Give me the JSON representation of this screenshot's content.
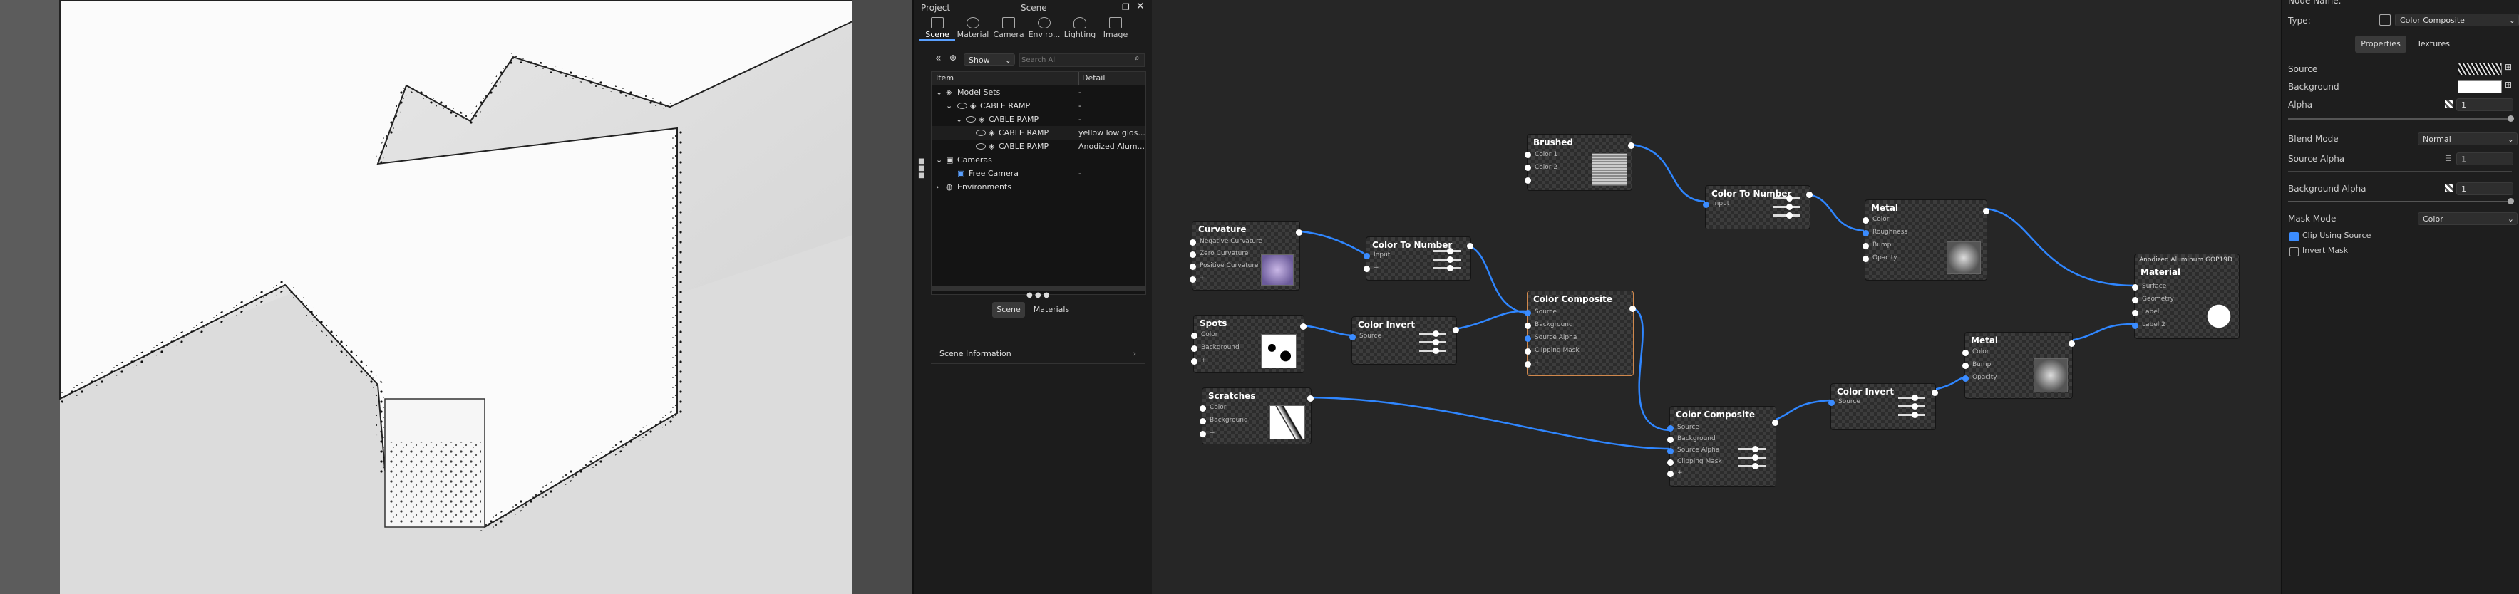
{
  "scene_panel": {
    "project_label": "Project",
    "scene_label": "Scene",
    "tabs": [
      "Scene",
      "Material",
      "Camera",
      "Enviro...",
      "Lighting",
      "Image"
    ],
    "show_select": "Show",
    "search_placeholder": "Search All",
    "columns": [
      "Item",
      "Detail"
    ],
    "rows": [
      {
        "label": "Model Sets",
        "detail": "-"
      },
      {
        "label": "CABLE RAMP",
        "detail": "-"
      },
      {
        "label": "CABLE RAMP",
        "detail": "-"
      },
      {
        "label": "CABLE RAMP",
        "detail": "yellow low glos..."
      },
      {
        "label": "CABLE RAMP",
        "detail": "Anodized Alum..."
      },
      {
        "label": "Cameras",
        "detail": ""
      },
      {
        "label": "Free Camera",
        "detail": "-"
      },
      {
        "label": "Environments",
        "detail": ""
      }
    ],
    "bottom_tabs": [
      "Scene",
      "Materials"
    ],
    "scene_information": "Scene Information"
  },
  "nodes": {
    "brushed": {
      "title": "Brushed",
      "ports": [
        "Color 1",
        "Color 2",
        ""
      ]
    },
    "curvature": {
      "title": "Curvature",
      "ports": [
        "Negative Curvature",
        "Zero Curvature",
        "Positive Curvature",
        "+"
      ]
    },
    "c2n_1": {
      "title": "Color To Number",
      "ports": [
        "Input",
        "+"
      ]
    },
    "c2n_2": {
      "title": "Color To Number",
      "ports": [
        "Input"
      ]
    },
    "metal_1": {
      "title": "Metal",
      "ports": [
        "Color",
        "Roughness",
        "Bump",
        "Opacity"
      ]
    },
    "spots": {
      "title": "Spots",
      "ports": [
        "Color",
        "Background",
        "+"
      ]
    },
    "invert_1": {
      "title": "Color Invert",
      "ports": [
        "Source"
      ]
    },
    "composite_1": {
      "title": "Color Composite",
      "ports": [
        "Source",
        "Background",
        "Source Alpha",
        "Clipping Mask",
        "+"
      ]
    },
    "metal_2": {
      "title": "Metal",
      "ports": [
        "Color",
        "Bump",
        "Opacity"
      ]
    },
    "material": {
      "title": "Material",
      "header": "Anodized Aluminum GOP19D",
      "ports": [
        "Surface",
        "Geometry",
        "Label",
        "Label 2"
      ]
    },
    "scratches": {
      "title": "Scratches",
      "ports": [
        "Color",
        "Background",
        "+"
      ]
    },
    "composite_2": {
      "title": "Color Composite",
      "ports": [
        "Source",
        "Background",
        "Source Alpha",
        "Clipping Mask",
        "+"
      ]
    },
    "invert_2": {
      "title": "Color Invert",
      "ports": [
        "Source"
      ]
    }
  },
  "properties": {
    "node_name_label": "Node Name:",
    "type_label": "Type:",
    "type_value": "Color Composite",
    "tabs": [
      "Properties",
      "Textures"
    ],
    "source_label": "Source",
    "background_label": "Background",
    "alpha_label": "Alpha",
    "alpha_value": "1",
    "blend_mode_label": "Blend Mode",
    "blend_mode_value": "Normal",
    "source_alpha_label": "Source Alpha",
    "source_alpha_value": "1",
    "background_alpha_label": "Background Alpha",
    "background_alpha_value": "1",
    "mask_mode_label": "Mask Mode",
    "mask_mode_value": "Color",
    "clip_label": "Clip Using Source",
    "invert_mask_label": "Invert Mask"
  },
  "colors": {
    "accent": "#3b8cff",
    "selected_node": "#d0884c",
    "model_yellow": "#c8c23c"
  }
}
